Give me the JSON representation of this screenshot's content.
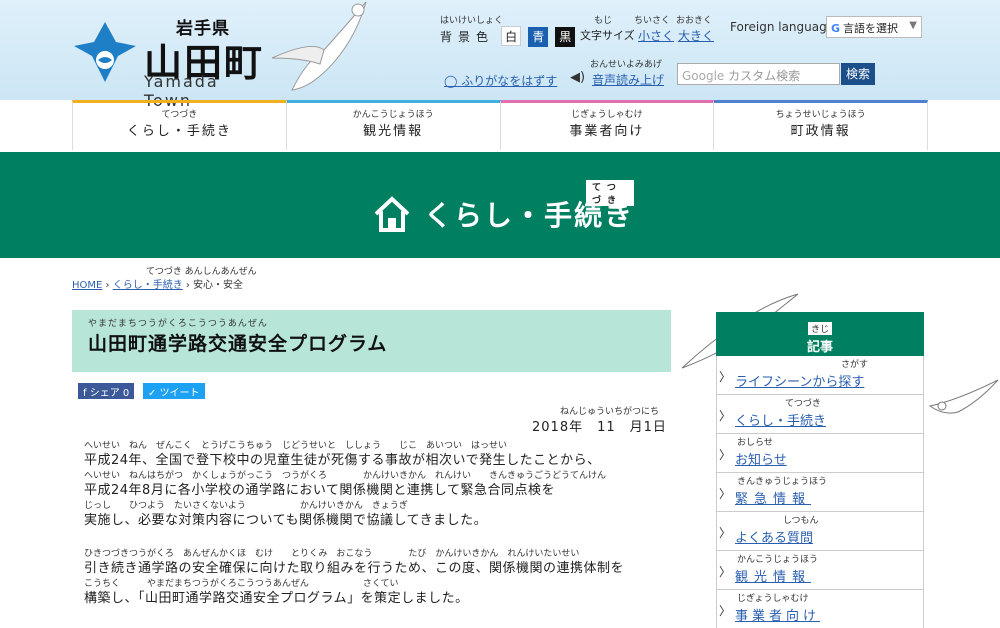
{
  "header": {
    "pref": "岩手県",
    "town_name": "山田町",
    "town_roman": "Yamada Town",
    "bg_color": {
      "ruby": "はいけいしょく",
      "label": "背景色",
      "options": [
        "白",
        "青",
        "黒"
      ]
    },
    "text_size": {
      "ruby": "もじ",
      "label": "文字サイズ",
      "small_ruby": "ちいさく",
      "small": "小さく",
      "large_ruby": "おおきく",
      "large": "大きく"
    },
    "foreign_label": "Foreign language:",
    "translate_label": "言語を選択",
    "furigana_off": "ふりがなをはずす",
    "read_aloud_ruby": "おんせいよみあげ",
    "read_aloud": "音声読み上げ",
    "search_placeholder": "カスタム検索",
    "search_button": "検索"
  },
  "colors": {
    "accent": "#008060",
    "light_accent": "#b7e6d9",
    "header_bg": "#d6ecf8",
    "link": "#2a5fb0"
  },
  "nav": [
    {
      "ruby": "てつづき",
      "label": "くらし・手続き",
      "color": "#f0b020"
    },
    {
      "ruby": "かんこうじょうほう",
      "label": "観光情報",
      "color": "#40b0e0"
    },
    {
      "ruby": "じぎょうしゃむけ",
      "label": "事業者向け",
      "color": "#e070b0"
    },
    {
      "ruby": "ちょうせいじょうほう",
      "label": "町政情報",
      "color": "#5080d0"
    }
  ],
  "band": {
    "title": "くらし・手続き",
    "ruby": "てつづき"
  },
  "breadcrumb": {
    "home": "HOME",
    "level1": "くらし・手続き",
    "current": "安心・安全",
    "ruby": "てつづき あんしんあんぜん"
  },
  "article": {
    "title_ruby": "やまだまちつうがくろこうつうあんぜん",
    "title": "山田町通学路交通安全プログラム",
    "share_fb": "シェア 0",
    "share_tw": "ツイート",
    "date_ruby": "ねんじゅういちがつにち",
    "date": "2018年　11　月1日",
    "paragraphs": [
      {
        "ruby": "へいせい　ねん　ぜんこく　とうげこうちゅう　じどうせいと　ししょう　　じこ　あいつい　はっせい",
        "text": "平成24年、全国で登下校中の児童生徒が死傷する事故が相次いで発生したことから、"
      },
      {
        "ruby": "へいせい　ねんはちがつ　かくしょうがっこう　つうがくろ　　　　かんけいきかん　れんけい　　きんきゅうごうどうてんけん",
        "text": "平成24年8月に各小学校の通学路において関係機関と連携して緊急合同点検を"
      },
      {
        "ruby": "じっし　　ひつよう　たいさくないよう　　　　　　かんけいきかん　きょうぎ",
        "text": "実施し、必要な対策内容についても関係機関で協議してきました。"
      },
      {
        "ruby": "ひきつづきつうがくろ　あんぜんかくほ　むけ　　とりくみ　おこなう　　　　たび　かんけいきかん　れんけいたいせい",
        "text": "引き続き通学路の安全確保に向けた取り組みを行うため、この度、関係機関の連携体制を"
      },
      {
        "ruby": "こうちく　　　やまだまちつうがくろこうつうあんぜん　　　　　　さくてい",
        "text": "構築し、「山田町通学路交通安全プログラム」を策定しました。"
      }
    ]
  },
  "sidebar": {
    "head_ruby": "きじ",
    "head": "記事",
    "items": [
      {
        "ruby": "さがす",
        "label": "ライフシーンから探す"
      },
      {
        "ruby": "てつづき",
        "label": "くらし・手続き"
      },
      {
        "ruby": "おしらせ",
        "label": "お知らせ"
      },
      {
        "ruby": "きんきゅうじょうほう",
        "label": "緊急情報"
      },
      {
        "ruby": "しつもん",
        "label": "よくある質問"
      },
      {
        "ruby": "かんこうじょうほう",
        "label": "観光情報"
      },
      {
        "ruby": "じぎょうしゃむけ",
        "label": "事業者向け"
      }
    ]
  }
}
